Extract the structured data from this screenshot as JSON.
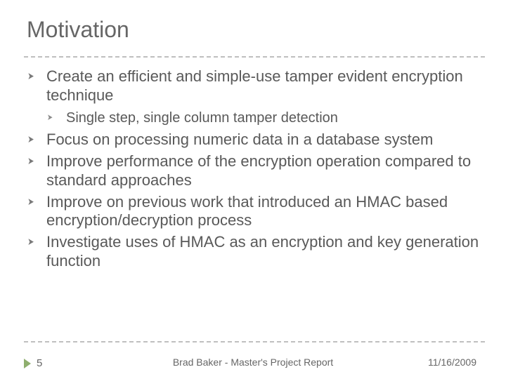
{
  "title": "Motivation",
  "bullets": {
    "b0": "Create an efficient and simple-use tamper evident encryption technique",
    "b0_sub0": "Single step, single column tamper detection",
    "b1": "Focus on processing numeric data in a database system",
    "b2": "Improve performance of the encryption operation compared to standard approaches",
    "b3": "Improve on previous work that introduced an HMAC based encryption/decryption process",
    "b4": "Investigate uses of HMAC as an encryption and key generation function"
  },
  "footer": {
    "page": "5",
    "center": "Brad Baker - Master's Project Report",
    "date": "11/16/2009"
  }
}
